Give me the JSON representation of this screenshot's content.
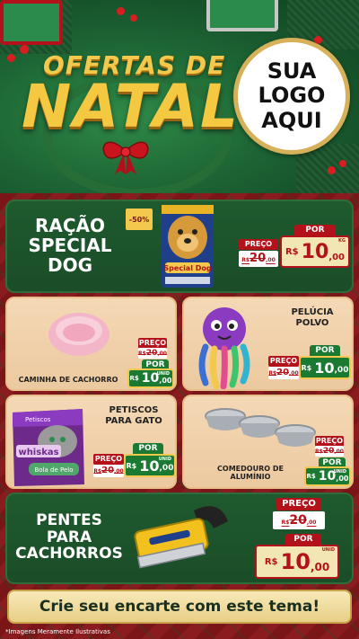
{
  "header": {
    "title_top": "OFERTAS DE",
    "title_main": "NATAL",
    "logo_lines": [
      "SUA",
      "LOGO",
      "AQUI"
    ]
  },
  "products": [
    {
      "name_lines": [
        "RAÇÃO",
        "SPECIAL",
        "DOG"
      ],
      "discount_badge": "-50%",
      "pack_text": "Special Dog",
      "preco_label": "PREÇO",
      "old_currency": "R$",
      "old_price": "20",
      "old_cents": ",00",
      "por_label": "POR",
      "currency": "R$",
      "price": "10",
      "cents": ",00",
      "unit": "KG"
    },
    {
      "name": "CAMINHA DE CACHORRO",
      "preco_label": "PREÇO",
      "old_currency": "R$",
      "old_price": "20",
      "old_cents": ",00",
      "por_label": "POR",
      "currency": "R$",
      "price": "10",
      "cents": ",00",
      "unit": "UNID"
    },
    {
      "name_lines": [
        "PELÚCIA",
        "POLVO"
      ],
      "preco_label": "PREÇO",
      "old_currency": "R$",
      "old_price": "20",
      "old_cents": ",00",
      "por_label": "POR",
      "currency": "R$",
      "price": "10",
      "cents": ",00",
      "unit": ""
    },
    {
      "name_lines": [
        "PETISCOS",
        "PARA GATO"
      ],
      "pack_brand": "whiskas",
      "pack_top": "Petiscos",
      "pack_sub": "Bola de Pelo",
      "preco_label": "PREÇO",
      "old_currency": "R$",
      "old_price": "20",
      "old_cents": ",00",
      "por_label": "POR",
      "currency": "R$",
      "price": "10",
      "cents": ",00",
      "unit": "UNID"
    },
    {
      "name_lines": [
        "COMEDOURO DE",
        "ALUMÍNIO"
      ],
      "preco_label": "PREÇO",
      "old_currency": "R$",
      "old_price": "20",
      "old_cents": ",00",
      "por_label": "POR",
      "currency": "R$",
      "price": "10",
      "cents": ",00",
      "unit": "UNID"
    },
    {
      "name_lines": [
        "PENTES",
        "PARA",
        "CACHORROS"
      ],
      "preco_label": "PREÇO",
      "old_currency": "R$",
      "old_price": "20",
      "old_cents": ",00",
      "por_label": "POR",
      "currency": "R$",
      "price": "10",
      "cents": ",00",
      "unit": "UNID"
    }
  ],
  "footer": {
    "cta": "Crie seu encarte com este tema!",
    "disclaimer": "*Imagens Meramente Ilustrativas"
  },
  "colors": {
    "dark_green": "#1f5a2e",
    "beige": "#f4d8b5",
    "red": "#b4121a",
    "gold": "#f2c94c",
    "price_green": "#1a7a32"
  }
}
